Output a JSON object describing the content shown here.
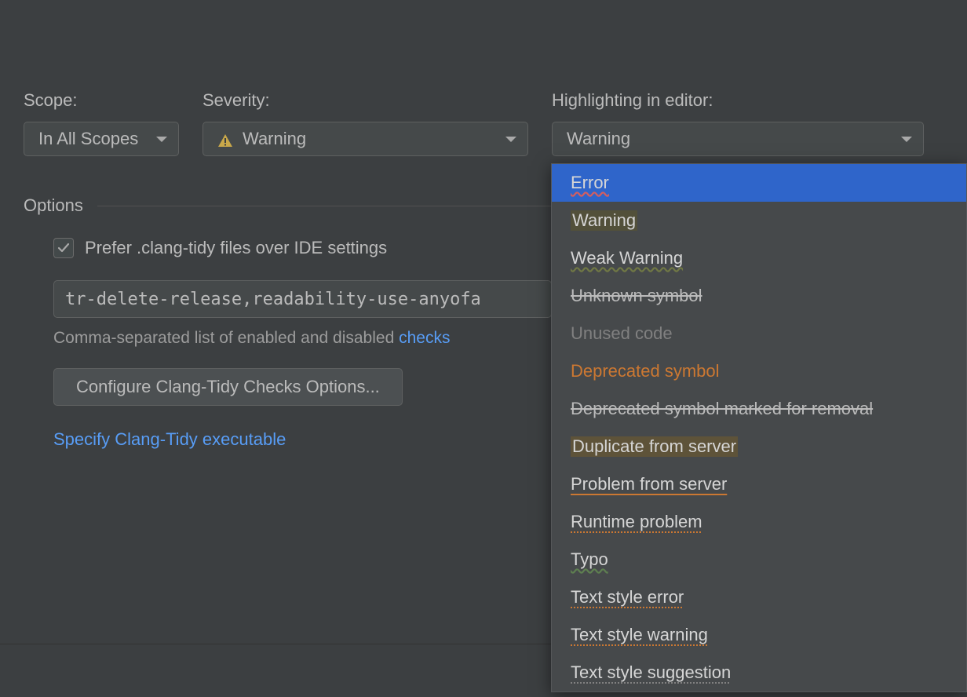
{
  "scope": {
    "label": "Scope:",
    "value": "In All Scopes"
  },
  "severity": {
    "label": "Severity:",
    "value": "Warning"
  },
  "highlighting": {
    "label": "Highlighting in editor:",
    "value": "Warning"
  },
  "options": {
    "title": "Options",
    "prefer_checkbox": "Prefer .clang-tidy files over IDE settings",
    "checks_value": "tr-delete-release,readability-use-anyofa",
    "helper_text_prefix": "Comma-separated list of enabled and disabled ",
    "helper_link": "checks",
    "configure_button": "Configure Clang-Tidy Checks Options...",
    "specify_link": "Specify Clang-Tidy executable"
  },
  "popup_items": [
    {
      "label": "Error",
      "cls": "hl-error"
    },
    {
      "label": "Warning",
      "cls": "hl-warning-bg"
    },
    {
      "label": "Weak Warning",
      "cls": "hl-weak"
    },
    {
      "label": "Unknown symbol",
      "cls": "hl-unknown"
    },
    {
      "label": "Unused code",
      "cls": "hl-unused"
    },
    {
      "label": "Deprecated symbol",
      "cls": "hl-deprecated"
    },
    {
      "label": "Deprecated symbol marked for removal",
      "cls": "hl-deprecated-removal"
    },
    {
      "label": "Duplicate from server",
      "cls": "hl-duplicate"
    },
    {
      "label": "Problem from server",
      "cls": "hl-problem-server"
    },
    {
      "label": "Runtime problem",
      "cls": "hl-runtime"
    },
    {
      "label": "Typo",
      "cls": "hl-typo"
    },
    {
      "label": "Text style error",
      "cls": "hl-text-error"
    },
    {
      "label": "Text style warning",
      "cls": "hl-text-warning"
    },
    {
      "label": "Text style suggestion",
      "cls": "hl-text-suggestion"
    }
  ]
}
